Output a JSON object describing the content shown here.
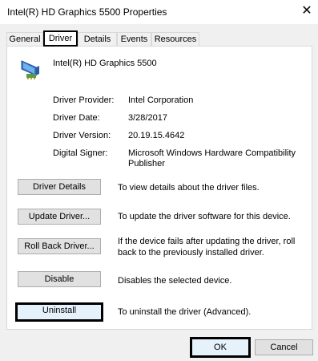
{
  "window": {
    "title": "Intel(R) HD Graphics 5500 Properties",
    "close_glyph": "✕"
  },
  "tabs": [
    {
      "label": "General"
    },
    {
      "label": "Driver",
      "active": true
    },
    {
      "label": "Details"
    },
    {
      "label": "Events"
    },
    {
      "label": "Resources"
    }
  ],
  "device": {
    "name": "Intel(R) HD Graphics 5500",
    "icon": "display-adapter-icon"
  },
  "info": {
    "provider_label": "Driver Provider:",
    "provider_value": "Intel Corporation",
    "date_label": "Driver Date:",
    "date_value": "3/28/2017",
    "version_label": "Driver Version:",
    "version_value": "20.19.15.4642",
    "signer_label": "Digital Signer:",
    "signer_value_line1": "Microsoft Windows Hardware Compatibility",
    "signer_value_line2": "Publisher"
  },
  "actions": {
    "details": {
      "label": "Driver Details",
      "desc": "To view details about the driver files."
    },
    "update": {
      "label": "Update Driver...",
      "desc": "To update the driver software for this device."
    },
    "rollback": {
      "label": "Roll Back Driver...",
      "desc_line1": "If the device fails after updating the driver, roll",
      "desc_line2": "back to the previously installed driver."
    },
    "disable": {
      "label": "Disable",
      "desc": "Disables the selected device."
    },
    "uninstall": {
      "label": "Uninstall",
      "desc": "To uninstall the driver (Advanced)."
    }
  },
  "footer": {
    "ok": "OK",
    "cancel": "Cancel"
  }
}
